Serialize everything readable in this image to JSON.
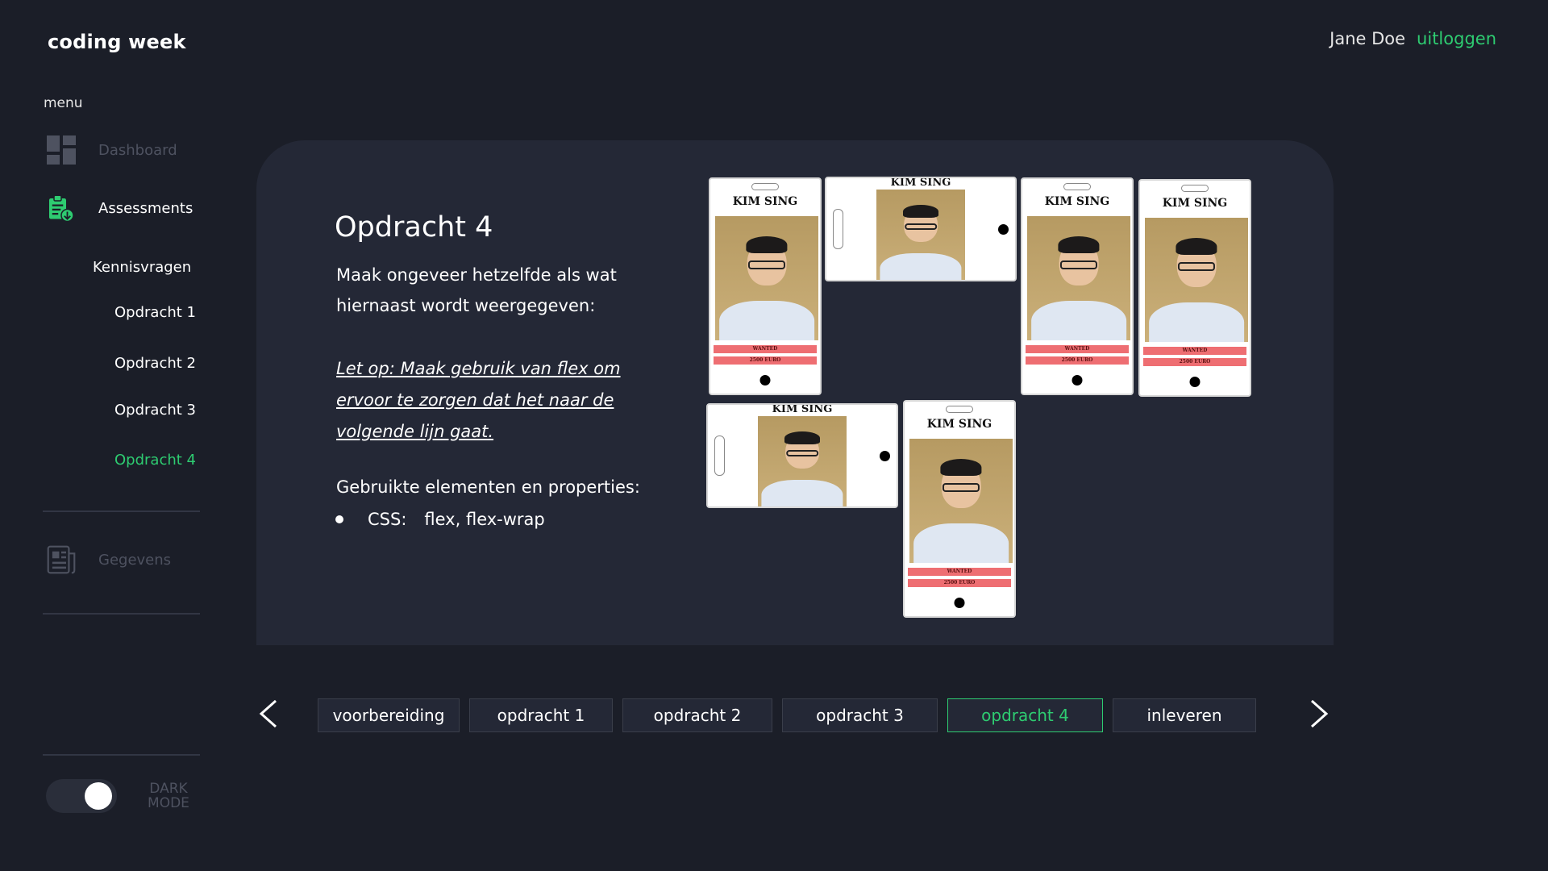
{
  "app": {
    "title": "coding week"
  },
  "user": {
    "name": "Jane Doe",
    "logout_label": "uitloggen"
  },
  "sidebar": {
    "menu_label": "menu",
    "items": [
      {
        "label": "Dashboard",
        "icon": "dashboard-icon",
        "state": "dim"
      },
      {
        "label": "Assessments",
        "icon": "clipboard-download-icon",
        "state": "active"
      },
      {
        "label": "Gegevens",
        "icon": "document-icon",
        "state": "dim"
      }
    ],
    "subitems": [
      {
        "label": "Kennisvragen"
      },
      {
        "label": "Opdracht 1"
      },
      {
        "label": "Opdracht 2"
      },
      {
        "label": "Opdracht 3"
      },
      {
        "label": "Opdracht 4",
        "current": true
      }
    ],
    "toggle_label": "DARK MODE",
    "dark_mode": true
  },
  "content": {
    "title": "Opdracht 4",
    "description": "Maak ongeveer hetzelfde als wat hiernaast wordt weergegeven:",
    "note": "Let op: Maak gebruik van flex om ervoor te zorgen dat het naar de volgende lijn gaat.",
    "used_heading": "Gebruikte elementen en properties:",
    "used_items": [
      {
        "key": "CSS:",
        "value": "flex, flex-wrap"
      }
    ],
    "badge": {
      "name": "KIM SING",
      "strip1": "WANTED",
      "strip2": "2500 EURO"
    }
  },
  "nav": {
    "prev_icon": "chevron-left-icon",
    "next_icon": "chevron-right-icon",
    "tabs": [
      {
        "label": "voorbereiding"
      },
      {
        "label": "opdracht 1"
      },
      {
        "label": "opdracht 2"
      },
      {
        "label": "opdracht 3"
      },
      {
        "label": "opdracht 4",
        "active": true
      },
      {
        "label": "inleveren"
      }
    ]
  },
  "colors": {
    "accent": "#2ecc71",
    "background": "#1b1e28",
    "card": "#242836"
  }
}
